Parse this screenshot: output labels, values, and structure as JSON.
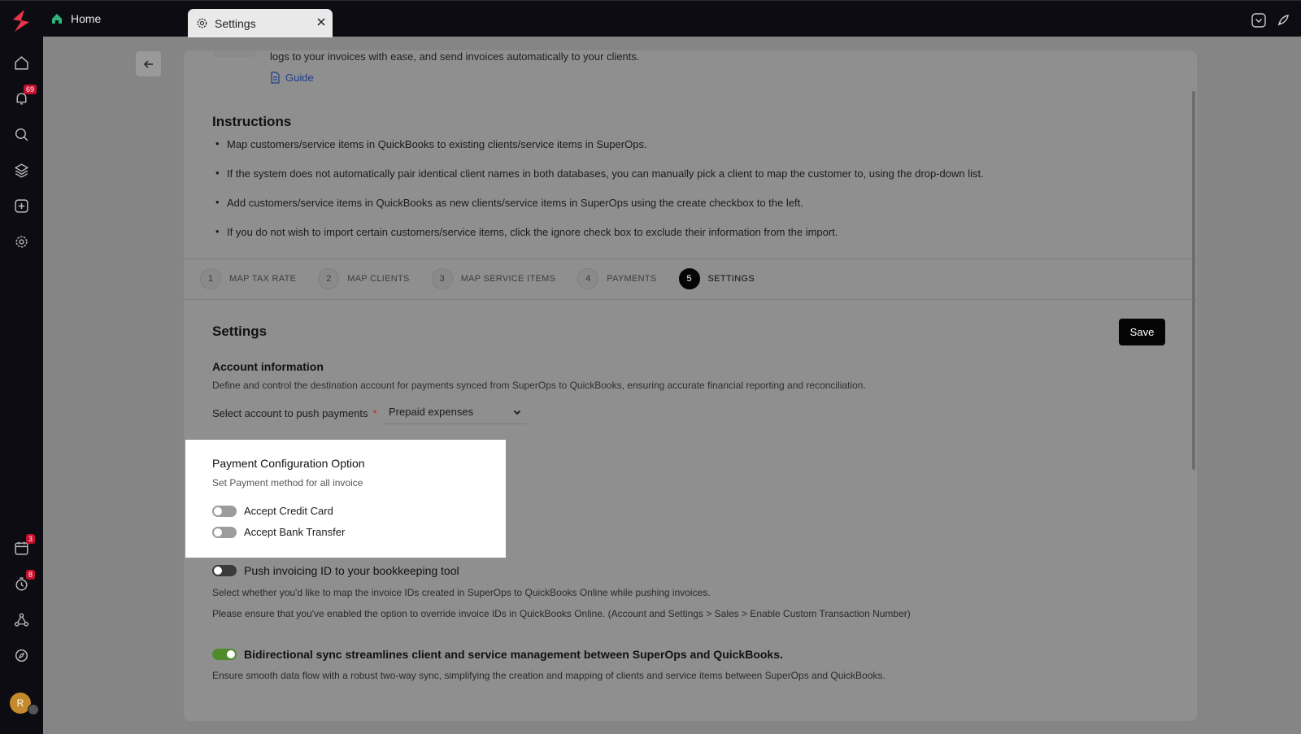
{
  "topbar": {
    "home_label": "Home",
    "settings_tab_label": "Settings",
    "logo_color": "#e8344a"
  },
  "sidebar": {
    "notifications_badge": "69",
    "calendar_badge": "3",
    "timer_badge": "8",
    "avatar_initial": "R"
  },
  "intro": {
    "text": "logs to your invoices with ease, and send invoices automatically to your clients.",
    "guide_label": "Guide"
  },
  "instructions": {
    "title": "Instructions",
    "items": [
      "Map customers/service items in QuickBooks to existing clients/service items in SuperOps.",
      "If the system does not automatically pair identical client names in both databases, you can manually pick a client to map the customer to, using the drop-down list.",
      "Add customers/service items in QuickBooks as new clients/service items in SuperOps using the create checkbox to the left.",
      "If you do not wish to import certain customers/service items, click the ignore check box to exclude their information from the import."
    ]
  },
  "steps": [
    {
      "num": "1",
      "label": "MAP TAX RATE"
    },
    {
      "num": "2",
      "label": "MAP CLIENTS"
    },
    {
      "num": "3",
      "label": "MAP SERVICE ITEMS"
    },
    {
      "num": "4",
      "label": "PAYMENTS"
    },
    {
      "num": "5",
      "label": "SETTINGS"
    }
  ],
  "settings": {
    "title": "Settings",
    "save_label": "Save",
    "account": {
      "title": "Account information",
      "description": "Define and control the destination account for payments synced from SuperOps to QuickBooks, ensuring accurate financial reporting and reconciliation.",
      "select_label": "Select account to push payments",
      "required_mark": "*",
      "selected_value": "Prepaid expenses"
    },
    "payment_config": {
      "title": "Payment Configuration Option",
      "subtitle": "Set Payment method for all invoice",
      "credit_card_label": "Accept Credit Card",
      "bank_transfer_label": "Accept Bank Transfer"
    },
    "push_invoice": {
      "label": "Push invoicing ID to your bookkeeping tool",
      "desc1": "Select whether you'd like to map the invoice IDs created in SuperOps to QuickBooks Online while pushing invoices.",
      "desc2": "Please ensure that you've enabled the option to override invoice IDs in QuickBooks Online. (Account and Settings > Sales > Enable Custom Transaction Number)"
    },
    "bidirectional": {
      "label": "Bidirectional sync streamlines client and service management between SuperOps and QuickBooks.",
      "desc": "Ensure smooth data flow with a robust two-way sync, simplifying the creation and mapping of clients and service items between SuperOps and QuickBooks.",
      "toggle_color": "#4f8b2b"
    }
  }
}
